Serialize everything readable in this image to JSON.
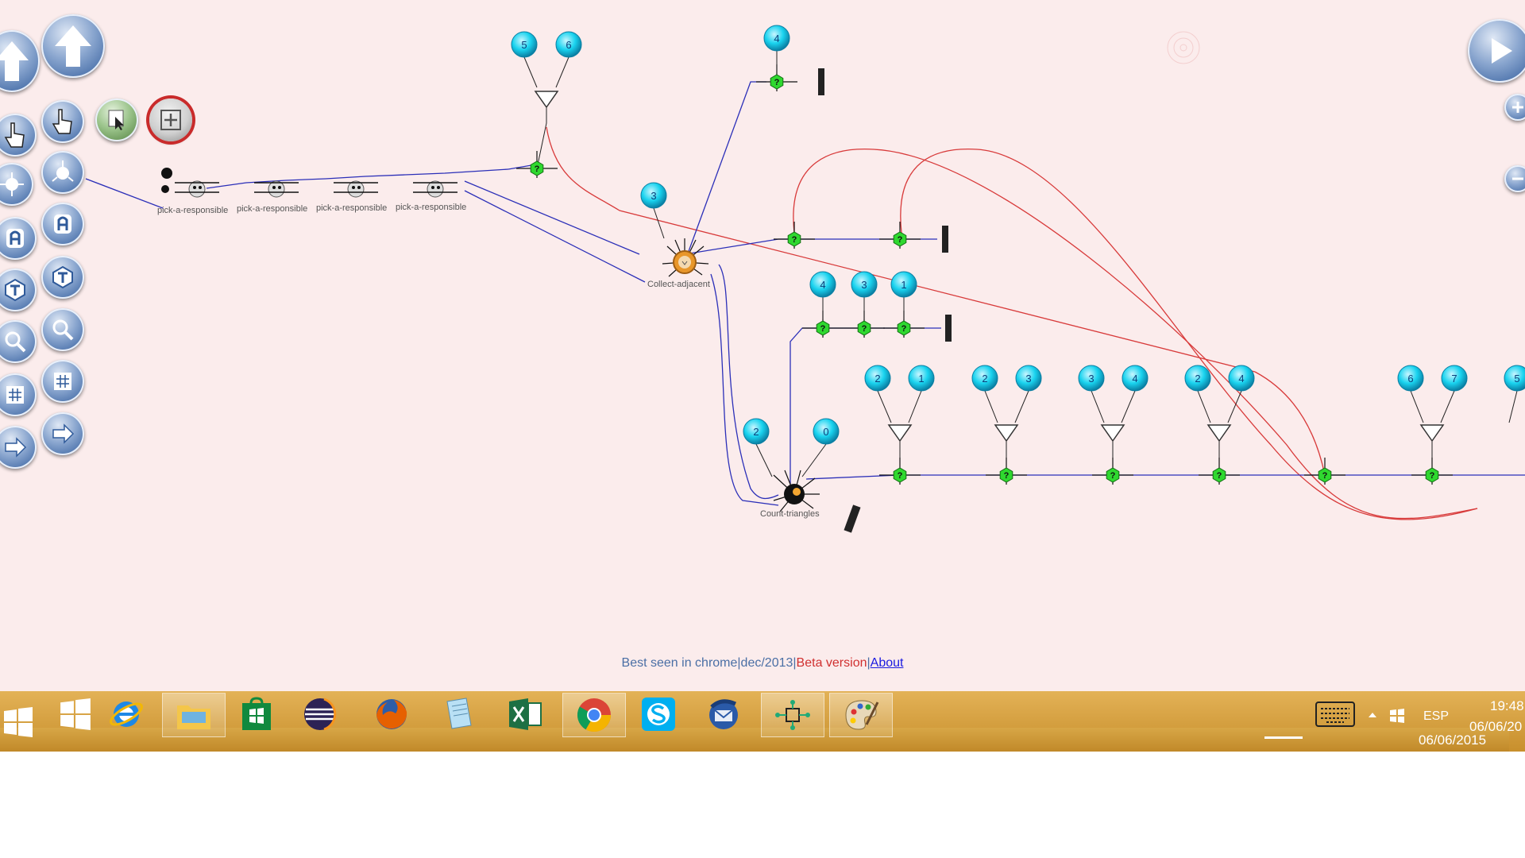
{
  "toolbar": {
    "left_tools": [
      "arrow-up-icon",
      "pointer-hand-icon",
      "select-arrow-icon",
      "add-node-icon",
      "connect-node-icon",
      "text-a-icon",
      "text-t-icon",
      "zoom-icon",
      "grid-icon",
      "export-arrow-icon"
    ],
    "right_tools": [
      "play-icon",
      "zoom-in-icon",
      "zoom-out-icon"
    ]
  },
  "graph": {
    "accent_blue": "#2b2fb8",
    "accent_red": "#d83a3a",
    "node_fill": "#19d3ef",
    "decision_fill": "#2fd82f",
    "labels": {
      "pick1": "pick-a-responsible",
      "pick2": "pick-a-responsible",
      "pick3": "pick-a-responsible",
      "pick4": "pick-a-responsible",
      "collect": "Collect-adjacent",
      "count": "Count-triangles"
    },
    "numbers": {
      "t1a": "5",
      "t1b": "6",
      "t2": "4",
      "t3": "3",
      "r1a": "4",
      "r1b": "3",
      "r1c": "1",
      "bc1": "2",
      "bc2": "0",
      "m1a": "2",
      "m1b": "1",
      "m2a": "2",
      "m2b": "3",
      "m3a": "3",
      "m3b": "4",
      "m4a": "2",
      "m4b": "4",
      "m5a": "6",
      "m5b": "7",
      "m6a": "5"
    }
  },
  "footer": {
    "best_seen": "Best seen in chrome|dec/2013|",
    "beta": "Beta version",
    "separator": "|",
    "about": "About"
  },
  "taskbar": {
    "apps": [
      "windows-start-icon",
      "internet-explorer-icon",
      "file-explorer-icon",
      "windows-store-icon",
      "eclipse-icon",
      "firefox-icon",
      "notepad-icon",
      "excel-icon",
      "chrome-icon",
      "skype-icon",
      "thunderbird-icon",
      "network-app-icon",
      "paint-icon"
    ],
    "tray": {
      "keyboard_icon": "keyboard-icon",
      "language": "ESP",
      "time": "19:48",
      "date": "06/06/20",
      "ghost_date": "06/06/2015"
    }
  }
}
